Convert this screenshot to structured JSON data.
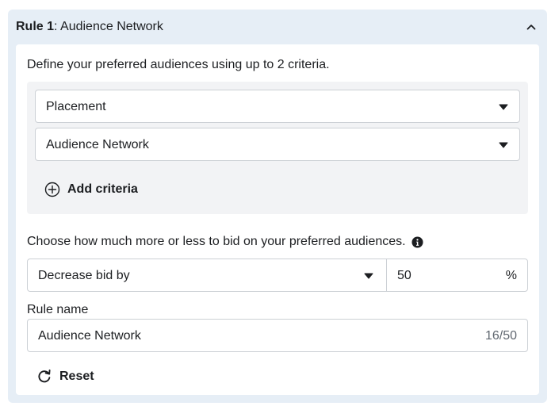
{
  "header": {
    "rule_prefix": "Rule 1",
    "rule_title": ": Audience Network",
    "collapse_icon": "chevron-up-icon"
  },
  "criteria": {
    "description": "Define your preferred audiences using up to 2 criteria.",
    "selects": [
      {
        "value": "Placement"
      },
      {
        "value": "Audience Network"
      }
    ],
    "add_label": "Add criteria",
    "add_icon": "plus-circle-icon"
  },
  "bid": {
    "description": "Choose how much more or less to bid on your preferred audiences.",
    "info_icon": "info-icon",
    "adjustment_select": "Decrease bid by",
    "amount": "50",
    "unit": "%"
  },
  "rule_name": {
    "label": "Rule name",
    "value": "Audience Network",
    "counter": "16/50"
  },
  "reset": {
    "label": "Reset",
    "icon": "refresh-icon"
  },
  "colors": {
    "outer_bg": "#e6eef6",
    "criteria_bg": "#f2f3f5",
    "border": "#ccd0d5",
    "text": "#1c1e21",
    "muted": "#606770"
  }
}
